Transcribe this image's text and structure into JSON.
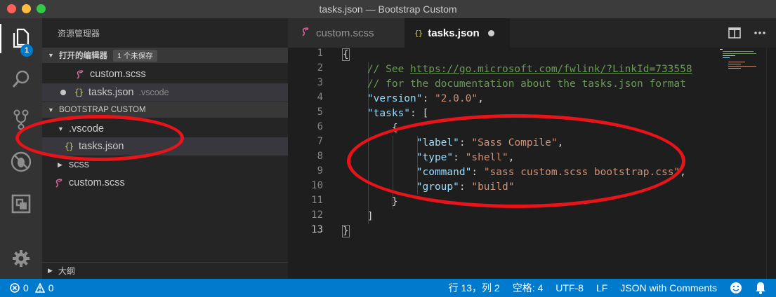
{
  "window": {
    "title": "tasks.json — Bootstrap Custom"
  },
  "activity_bar": {
    "items": [
      {
        "name": "explorer",
        "icon": "files-icon",
        "badge": "1"
      },
      {
        "name": "search",
        "icon": "search-icon"
      },
      {
        "name": "source-control",
        "icon": "source-control-icon"
      },
      {
        "name": "debug",
        "icon": "debug-icon"
      },
      {
        "name": "extensions",
        "icon": "extensions-icon"
      },
      {
        "name": "settings",
        "icon": "gear-icon"
      }
    ]
  },
  "sidebar": {
    "title": "资源管理器",
    "open_editors": {
      "header": "打开的编辑器",
      "unsaved_badge": "1 个未保存",
      "items": [
        {
          "name": "custom.scss"
        },
        {
          "name": "tasks.json",
          "folder": ".vscode"
        }
      ]
    },
    "project": {
      "header": "BOOTSTRAP CUSTOM",
      "folder": ".vscode",
      "folder_file": "tasks.json",
      "scss_folder": "scss",
      "root_file": "custom.scss"
    },
    "outline": "大纲"
  },
  "tabs": [
    {
      "label": "custom.scss"
    },
    {
      "label": "tasks.json"
    }
  ],
  "editor": {
    "line_numbers": [
      "1",
      "2",
      "3",
      "4",
      "5",
      "6",
      "7",
      "8",
      "9",
      "10",
      "11",
      "12",
      "13"
    ],
    "code": {
      "l2_comment": "// See ",
      "l2_link": "https://go.microsoft.com/fwlink/?LinkId=733558",
      "l3_comment": "// for the documentation about the tasks.json format",
      "version_key": "\"version\"",
      "version_val": "\"2.0.0\"",
      "tasks_key": "\"tasks\"",
      "label_key": "\"label\"",
      "label_val": "\"Sass Compile\"",
      "type_key": "\"type\"",
      "type_val": "\"shell\"",
      "command_key": "\"command\"",
      "command_val": "\"sass custom.scss bootstrap.css\"",
      "group_key": "\"group\"",
      "group_val": "\"build\""
    }
  },
  "status_bar": {
    "errors": "0",
    "warnings": "0",
    "position": "行 13，列 2",
    "indent": "空格: 4",
    "encoding": "UTF-8",
    "eol": "LF",
    "language": "JSON with Comments"
  },
  "colors": {
    "accent": "#007acc",
    "annotation": "#e8141a",
    "json_icon": "#cbcb41",
    "scss_icon": "#cd6799"
  }
}
